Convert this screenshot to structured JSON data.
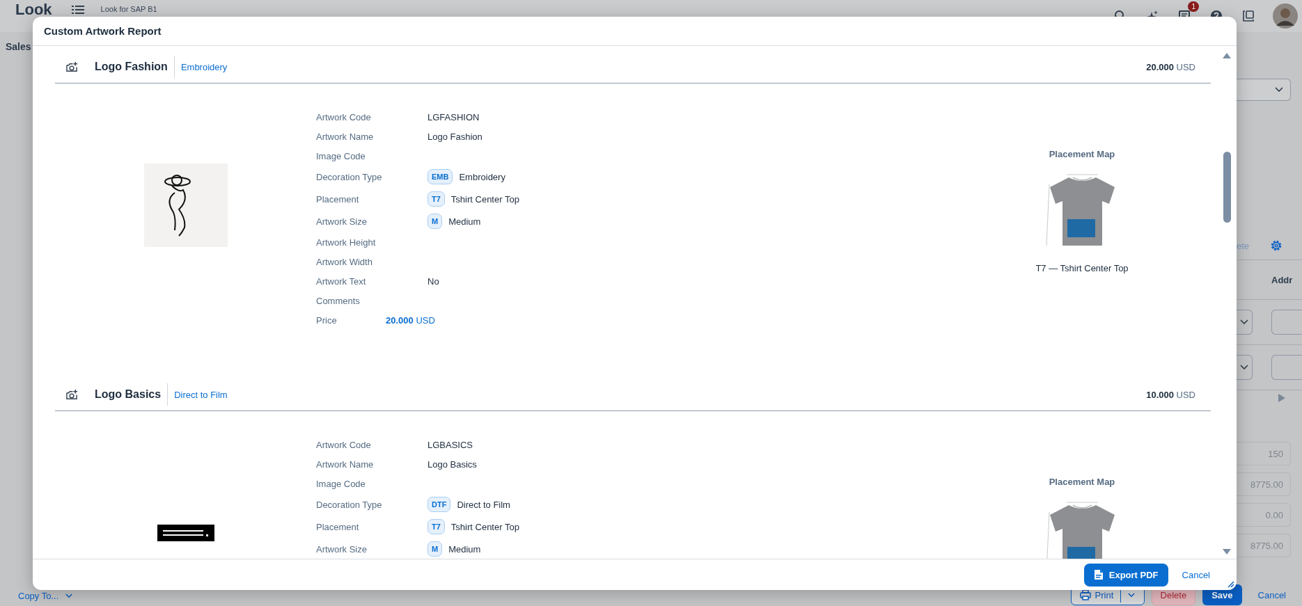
{
  "app_header": {
    "logo": "Look",
    "title": "Look for SAP B1",
    "notification_count": "1"
  },
  "page": {
    "title": "Sales",
    "toolbar_action": "ete",
    "column_header": "Addr",
    "totals": [
      "150",
      "8775.00",
      "0.00",
      "8775.00"
    ]
  },
  "footer_bar": {
    "copy_to": "Copy To...",
    "buttons": [
      {
        "label": "Print",
        "kind": "split"
      },
      {
        "label": "Delete",
        "kind": "negative"
      },
      {
        "label": "Save",
        "kind": "emphasized"
      },
      {
        "label": "Cancel",
        "kind": "transparent"
      }
    ]
  },
  "dialog": {
    "title": "Custom Artwork Report",
    "artworks": [
      {
        "name": "Logo Fashion",
        "decoration": "Embroidery",
        "price": "20.000",
        "currency": "USD",
        "fields": [
          {
            "label": "Artwork Code",
            "value": "LGFASHION"
          },
          {
            "label": "Artwork Name",
            "value": "Logo Fashion"
          },
          {
            "label": "Image Code"
          },
          {
            "label": "Decoration Type",
            "code": "EMB",
            "value": "Embroidery"
          },
          {
            "label": "Placement",
            "code": "T7",
            "value": "Tshirt Center Top"
          },
          {
            "label": "Artwork Size",
            "code": "M",
            "value": "Medium"
          },
          {
            "label": "Artwork Height"
          },
          {
            "label": "Artwork Width"
          },
          {
            "label": "Artwork Text",
            "value": "No"
          },
          {
            "label": "Comments"
          },
          {
            "label": "Price",
            "kind": "price",
            "value": "20.000",
            "currency": "USD"
          }
        ],
        "placement_map": {
          "title": "Placement Map",
          "caption": "T7 — Tshirt Center Top"
        }
      },
      {
        "name": "Logo Basics",
        "decoration": "Direct to Film",
        "price": "10.000",
        "currency": "USD",
        "fields": [
          {
            "label": "Artwork Code",
            "value": "LGBASICS"
          },
          {
            "label": "Artwork Name",
            "value": "Logo Basics"
          },
          {
            "label": "Image Code"
          },
          {
            "label": "Decoration Type",
            "code": "DTF",
            "value": "Direct to Film"
          },
          {
            "label": "Placement",
            "code": "T7",
            "value": "Tshirt Center Top"
          },
          {
            "label": "Artwork Size",
            "code": "M",
            "value": "Medium"
          }
        ],
        "placement_map": {
          "title": "Placement Map"
        }
      }
    ],
    "buttons": [
      {
        "label": "Export PDF",
        "kind": "emphasized"
      },
      {
        "label": "Cancel",
        "kind": "transparent"
      }
    ]
  }
}
